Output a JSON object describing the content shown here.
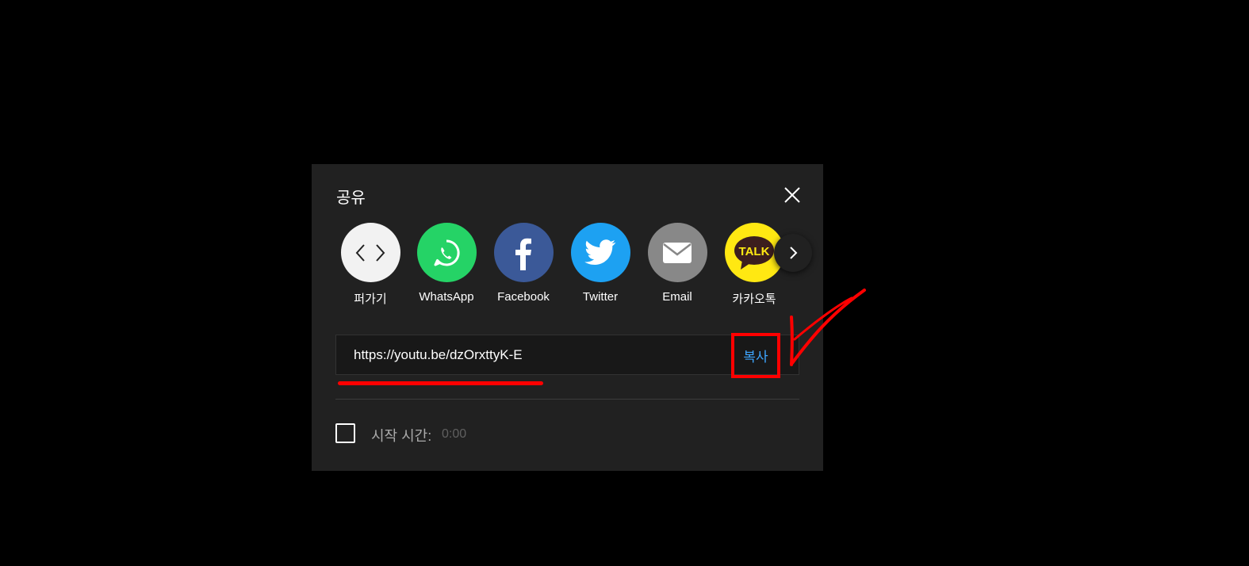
{
  "dialog": {
    "title": "공유",
    "close_icon": "close-icon"
  },
  "share_targets": [
    {
      "label": "퍼가기",
      "icon": "embed-icon",
      "color": "#f2f2f2"
    },
    {
      "label": "WhatsApp",
      "icon": "whatsapp-icon",
      "color": "#25d366"
    },
    {
      "label": "Facebook",
      "icon": "facebook-icon",
      "color": "#3b5998"
    },
    {
      "label": "Twitter",
      "icon": "twitter-icon",
      "color": "#1da1f2"
    },
    {
      "label": "Email",
      "icon": "email-icon",
      "color": "#888888"
    },
    {
      "label": "카카오톡",
      "icon": "kakaotalk-icon",
      "color": "#ffe812",
      "icon_text": "TALK"
    }
  ],
  "next_icon": "chevron-right-icon",
  "url_field": {
    "value": "https://youtu.be/dzOrxttyK-E",
    "copy_label": "복사"
  },
  "start_time": {
    "label": "시작 시간:",
    "value": "0:00"
  },
  "colors": {
    "background": "#000000",
    "dialog": "#212121",
    "accent_link": "#3ea6ff",
    "annotation": "#ff0000"
  }
}
